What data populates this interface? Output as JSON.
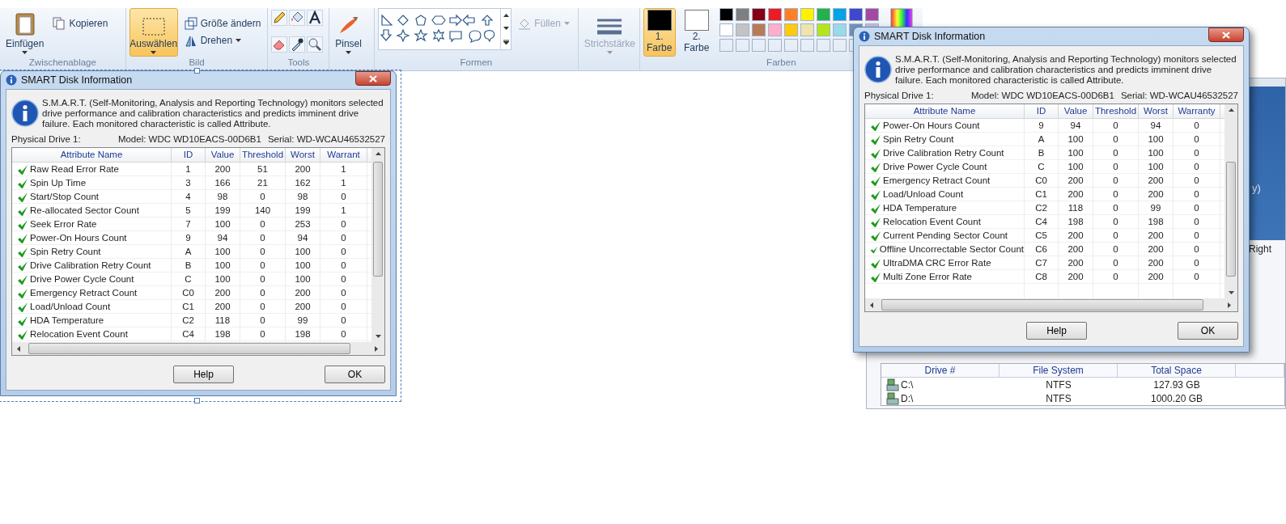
{
  "ribbon": {
    "clipboard": {
      "label": "Zwischenablage",
      "paste": "Einfügen",
      "copy": "Kopieren"
    },
    "image": {
      "label": "Bild",
      "select": {
        "label": "Auswählen",
        "selected": true
      },
      "resize": "Größe ändern",
      "rotate": "Drehen"
    },
    "tools": {
      "label": "Tools"
    },
    "brushes": {
      "label": "Pinsel"
    },
    "shapes": {
      "label": "Formen",
      "fill": {
        "label": "Füllen",
        "disabled": true
      }
    },
    "size": {
      "label": "Strichstärke",
      "disabled": true
    },
    "colors": {
      "label": "Farben",
      "color1": {
        "label": "1. Farbe",
        "selected": true,
        "color": "#000000"
      },
      "color2": {
        "label": "2. Farbe",
        "selected": false,
        "color": "#ffffff"
      },
      "palette": [
        {
          "color": "#000000"
        },
        {
          "color": "#7f7f7f"
        },
        {
          "color": "#880015"
        },
        {
          "color": "#ed1c24"
        },
        {
          "color": "#ff7f27"
        },
        {
          "color": "#fff200"
        },
        {
          "color": "#22b14c"
        },
        {
          "color": "#00a2e8"
        },
        {
          "color": "#3f48cc"
        },
        {
          "color": "#a349a4"
        },
        {
          "color": "#ffffff"
        },
        {
          "color": "#c3c3c3"
        },
        {
          "color": "#b97a57"
        },
        {
          "color": "#ffaec9"
        },
        {
          "color": "#ffc90e"
        },
        {
          "color": "#efe4b0"
        },
        {
          "color": "#b5e61d"
        },
        {
          "color": "#99d9ea"
        },
        {
          "color": "#7092be"
        },
        {
          "color": "#c8bfe7"
        }
      ]
    }
  },
  "windows": [
    {
      "title": "SMART Disk Information",
      "selected": true,
      "description": "S.M.A.R.T. (Self-Monitoring, Analysis and Reporting Technology) monitors selected drive performance and calibration characteristics and predicts imminent drive failure. Each monitored characteristic is called Attribute.",
      "drive": "Physical Drive 1:",
      "model": "Model: WDC WD10EACS-00D6B1",
      "serial": "Serial: WD-WCAU46532527",
      "columns": [
        "Attribute Name",
        "ID",
        "Value",
        "Threshold",
        "Worst",
        "Warrant"
      ],
      "rows": [
        {
          "name": "Raw Read Error Rate",
          "id": "1",
          "value": "200",
          "threshold": "51",
          "worst": "200",
          "warranty": "1",
          "ok": true
        },
        {
          "name": "Spin Up Time",
          "id": "3",
          "value": "166",
          "threshold": "21",
          "worst": "162",
          "warranty": "1",
          "ok": true
        },
        {
          "name": "Start/Stop Count",
          "id": "4",
          "value": "98",
          "threshold": "0",
          "worst": "98",
          "warranty": "0",
          "ok": true
        },
        {
          "name": "Re-allocated Sector Count",
          "id": "5",
          "value": "199",
          "threshold": "140",
          "worst": "199",
          "warranty": "1",
          "ok": true
        },
        {
          "name": "Seek Error Rate",
          "id": "7",
          "value": "100",
          "threshold": "0",
          "worst": "253",
          "warranty": "0",
          "ok": true
        },
        {
          "name": "Power-On Hours Count",
          "id": "9",
          "value": "94",
          "threshold": "0",
          "worst": "94",
          "warranty": "0",
          "ok": true
        },
        {
          "name": "Spin Retry Count",
          "id": "A",
          "value": "100",
          "threshold": "0",
          "worst": "100",
          "warranty": "0",
          "ok": true
        },
        {
          "name": "Drive Calibration Retry Count",
          "id": "B",
          "value": "100",
          "threshold": "0",
          "worst": "100",
          "warranty": "0",
          "ok": true
        },
        {
          "name": "Drive Power Cycle Count",
          "id": "C",
          "value": "100",
          "threshold": "0",
          "worst": "100",
          "warranty": "0",
          "ok": true
        },
        {
          "name": "Emergency Retract Count",
          "id": "C0",
          "value": "200",
          "threshold": "0",
          "worst": "200",
          "warranty": "0",
          "ok": true
        },
        {
          "name": "Load/Unload Count",
          "id": "C1",
          "value": "200",
          "threshold": "0",
          "worst": "200",
          "warranty": "0",
          "ok": true
        },
        {
          "name": "HDA Temperature",
          "id": "C2",
          "value": "118",
          "threshold": "0",
          "worst": "99",
          "warranty": "0",
          "ok": true
        },
        {
          "name": "Relocation Event Count",
          "id": "C4",
          "value": "198",
          "threshold": "0",
          "worst": "198",
          "warranty": "0",
          "ok": true
        }
      ],
      "buttons": [
        "Help",
        "OK"
      ]
    },
    {
      "title": "SMART Disk Information",
      "selected": false,
      "description": "S.M.A.R.T. (Self-Monitoring, Analysis and Reporting Technology) monitors selected drive performance and calibration characteristics and predicts imminent drive failure. Each monitored characteristic is called Attribute.",
      "drive": "Physical Drive 1:",
      "model": "Model: WDC WD10EACS-00D6B1",
      "serial": "Serial: WD-WCAU46532527",
      "columns": [
        "Attribute Name",
        "ID",
        "Value",
        "Threshold",
        "Worst",
        "Warranty"
      ],
      "rows": [
        {
          "name": "Power-On Hours Count",
          "id": "9",
          "value": "94",
          "threshold": "0",
          "worst": "94",
          "warranty": "0",
          "ok": true
        },
        {
          "name": "Spin Retry Count",
          "id": "A",
          "value": "100",
          "threshold": "0",
          "worst": "100",
          "warranty": "0",
          "ok": true
        },
        {
          "name": "Drive Calibration Retry Count",
          "id": "B",
          "value": "100",
          "threshold": "0",
          "worst": "100",
          "warranty": "0",
          "ok": true
        },
        {
          "name": "Drive Power Cycle Count",
          "id": "C",
          "value": "100",
          "threshold": "0",
          "worst": "100",
          "warranty": "0",
          "ok": true
        },
        {
          "name": "Emergency Retract Count",
          "id": "C0",
          "value": "200",
          "threshold": "0",
          "worst": "200",
          "warranty": "0",
          "ok": true
        },
        {
          "name": "Load/Unload Count",
          "id": "C1",
          "value": "200",
          "threshold": "0",
          "worst": "200",
          "warranty": "0",
          "ok": true
        },
        {
          "name": "HDA Temperature",
          "id": "C2",
          "value": "118",
          "threshold": "0",
          "worst": "99",
          "warranty": "0",
          "ok": true
        },
        {
          "name": "Relocation Event Count",
          "id": "C4",
          "value": "198",
          "threshold": "0",
          "worst": "198",
          "warranty": "0",
          "ok": true
        },
        {
          "name": "Current Pending Sector Count",
          "id": "C5",
          "value": "200",
          "threshold": "0",
          "worst": "200",
          "warranty": "0",
          "ok": true
        },
        {
          "name": "Offline Uncorrectable Sector Count",
          "id": "C6",
          "value": "200",
          "threshold": "0",
          "worst": "200",
          "warranty": "0",
          "ok": true
        },
        {
          "name": "UltraDMA CRC Error Rate",
          "id": "C7",
          "value": "200",
          "threshold": "0",
          "worst": "200",
          "warranty": "0",
          "ok": true
        },
        {
          "name": "Multi Zone Error Rate",
          "id": "C8",
          "value": "200",
          "threshold": "0",
          "worst": "200",
          "warranty": "0",
          "ok": true
        }
      ],
      "buttons": [
        "Help",
        "OK"
      ]
    }
  ],
  "background_app": {
    "panel_text": "y)",
    "toolbar_text": "Right",
    "drives": {
      "columns": [
        "Drive #",
        "File System",
        "Total Space"
      ],
      "rows": [
        {
          "drive": "C:\\",
          "file_system": "NTFS",
          "total": "127.93 GB"
        },
        {
          "drive": "D:\\",
          "file_system": "NTFS",
          "total": "1000.20 GB"
        }
      ]
    }
  }
}
